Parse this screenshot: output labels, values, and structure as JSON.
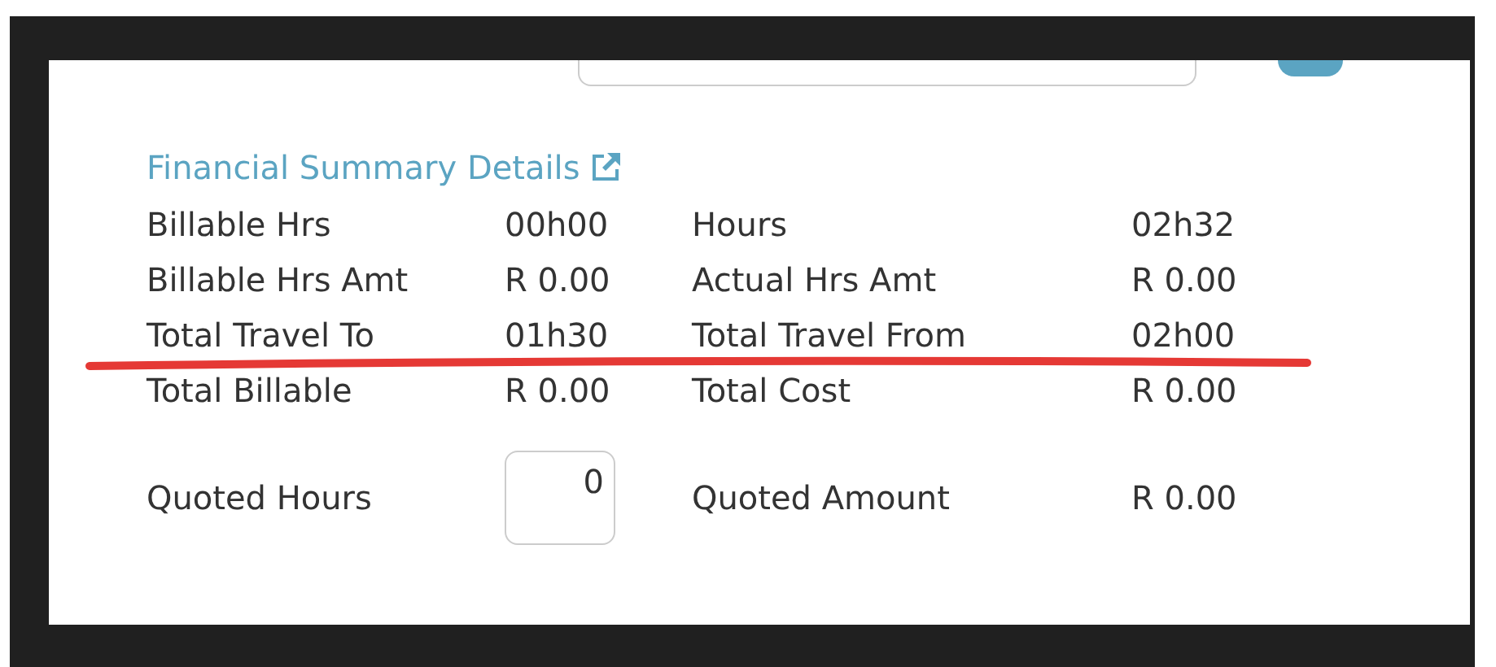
{
  "link": {
    "label": "Financial Summary Details"
  },
  "rows": [
    {
      "label": "Billable Hrs",
      "value": "00h00",
      "label_2": "Hours",
      "value_2": "02h32"
    },
    {
      "label": "Billable Hrs Amt",
      "value": "R 0.00",
      "label_2": "Actual Hrs Amt",
      "value_2": "R 0.00"
    },
    {
      "label": "Total Travel To",
      "value": "01h30",
      "label_2": "Total Travel From",
      "value_2": "02h00"
    },
    {
      "label": "Total Billable",
      "value": "R 0.00",
      "label_2": "Total Cost",
      "value_2": "R 0.00"
    },
    {
      "label": "Quoted Hours",
      "input_value": "0",
      "label_2": "Quoted Amount",
      "value_2": "R 0.00"
    }
  ]
}
